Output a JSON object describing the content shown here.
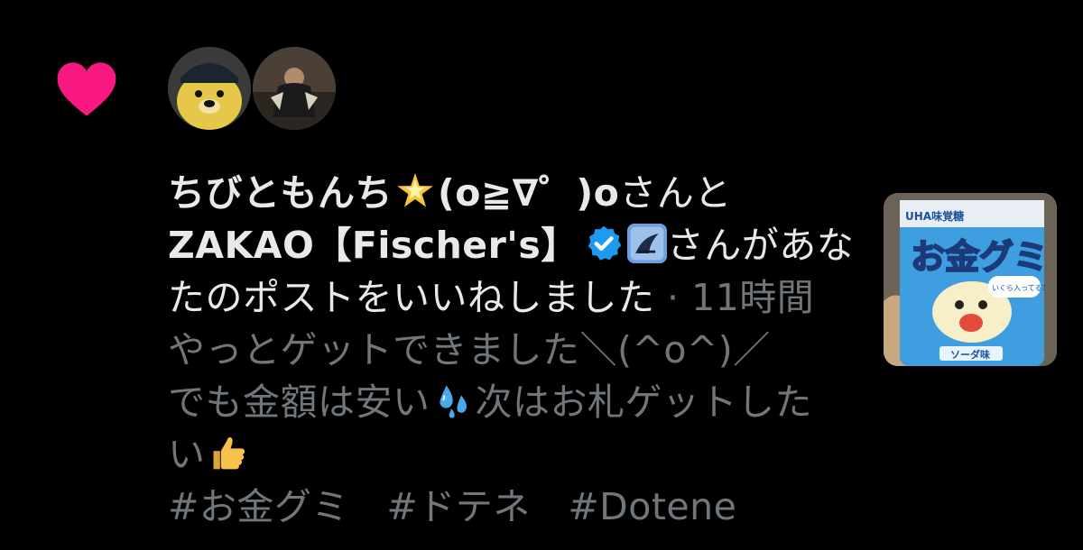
{
  "notification": {
    "type": "like",
    "heart_color": "#f91880",
    "actor1_name": "ちびともんち",
    "actor1_suffix": "(o≧∇゜)o",
    "connector1": "さんと",
    "actor2_name": "ZAKAO【Fischer's】",
    "connector2": "さんがあな",
    "line3_text": "たのポストをいいねしました",
    "separator": "·",
    "time": "11時間",
    "post_line1": "やっとゲットできました＼(^o^)／",
    "post_line2a": "でも金額は安い",
    "post_line2b": "次はお札ゲットした",
    "post_line3": "い",
    "hashtags": [
      "#お金グミ",
      "#ドテネ",
      "#Dotene"
    ],
    "icons": {
      "sparkle": "glowing-star-emoji",
      "verified": "verified-badge",
      "affiliate": "fischers-affiliate-badge",
      "sweat": "sweat-droplets-emoji",
      "thumbs": "thumbs-up-emoji"
    },
    "thumbnail": {
      "brand": "UHA味覚糖",
      "product": "お金グミ",
      "bubble": "いくら入ってる？",
      "flavor": "ソーダ味"
    }
  }
}
